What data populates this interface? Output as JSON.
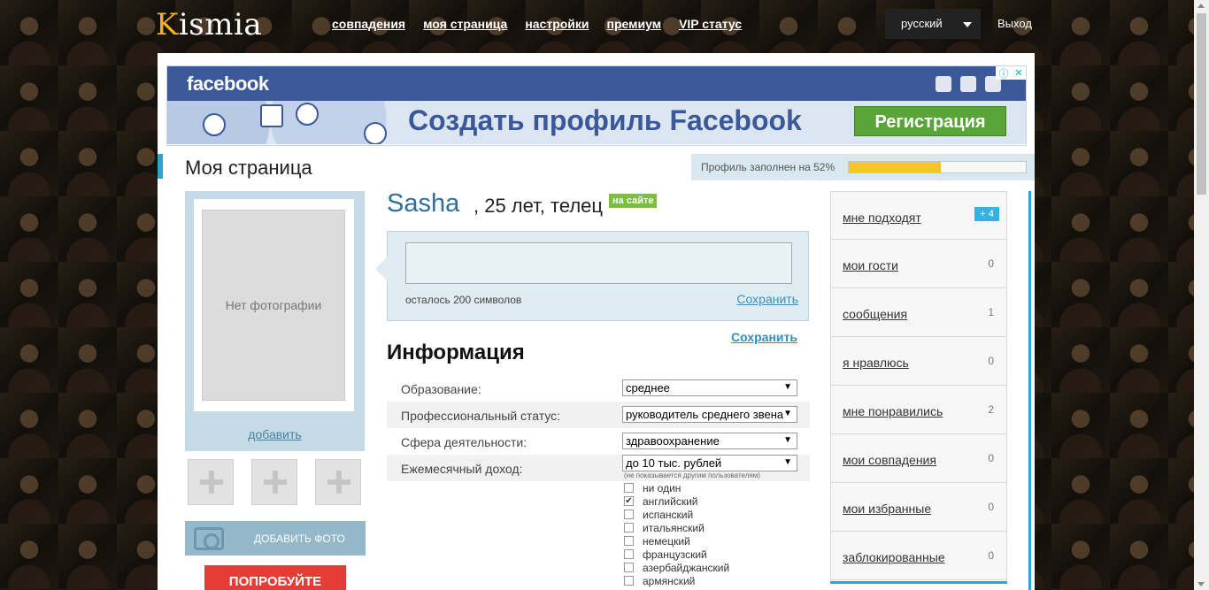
{
  "brand": {
    "logo_first": "K",
    "logo_rest": "ismia"
  },
  "nav": [
    {
      "label": "совпадения"
    },
    {
      "label": "моя страница"
    },
    {
      "label": "настройки"
    },
    {
      "label": "премиум"
    },
    {
      "label": "VIP статус"
    }
  ],
  "language": {
    "selected": "русский"
  },
  "logout_label": "Выход",
  "ad": {
    "brand": "facebook",
    "headline": "Создать профиль Facebook",
    "button": "Регистрация",
    "adchoices": "✕"
  },
  "page_title": "Моя страница",
  "profile_progress": {
    "label": "Профиль заполнен на 52%",
    "percent": 52
  },
  "photo": {
    "placeholder": "Нет фотографии",
    "add_link": "добавить",
    "add_photo_button": "ДОБАВИТЬ ФОТО"
  },
  "promo_banner": "ПОПРОБУЙТЕ",
  "profile": {
    "name": "Sasha",
    "details": ", 25 лет, телец",
    "online_badge": "на сайте"
  },
  "status": {
    "chars_left": "осталось 200 символов",
    "save": "Сохранить"
  },
  "info": {
    "save": "Сохранить",
    "title": "Информация",
    "rows": [
      {
        "label": "Образование:",
        "value": "среднее"
      },
      {
        "label": "Профессиональный статус:",
        "value": "руководитель среднего звена"
      },
      {
        "label": "Сфера деятельности:",
        "value": "здравоохранение"
      },
      {
        "label": "Ежемесячный доход:",
        "value": "до 10 тыс. рублей"
      }
    ],
    "income_note": "(не показывается другим пользователям)",
    "languages": [
      {
        "label": "ни один",
        "checked": false
      },
      {
        "label": "английский",
        "checked": true
      },
      {
        "label": "испанский",
        "checked": false
      },
      {
        "label": "итальянский",
        "checked": false
      },
      {
        "label": "немецкий",
        "checked": false
      },
      {
        "label": "французский",
        "checked": false
      },
      {
        "label": "азербайджанский",
        "checked": false
      },
      {
        "label": "армянский",
        "checked": false
      }
    ]
  },
  "side_menu": [
    {
      "label": "мне подходят",
      "count": "+ 4",
      "badge": true
    },
    {
      "label": "мои гости",
      "count": "0"
    },
    {
      "label": "сообщения",
      "count": "1"
    },
    {
      "label": "я нравлюсь",
      "count": "0"
    },
    {
      "label": "мне понравились",
      "count": "2"
    },
    {
      "label": "мои совпадения",
      "count": "0"
    },
    {
      "label": "мои избранные",
      "count": "0"
    },
    {
      "label": "заблокированные",
      "count": "0"
    }
  ],
  "colors": {
    "accent": "#28a7d7",
    "facebook": "#3b5998",
    "progress": "#f7c52a",
    "register": "#5aa53a",
    "online": "#7bbf3b"
  }
}
